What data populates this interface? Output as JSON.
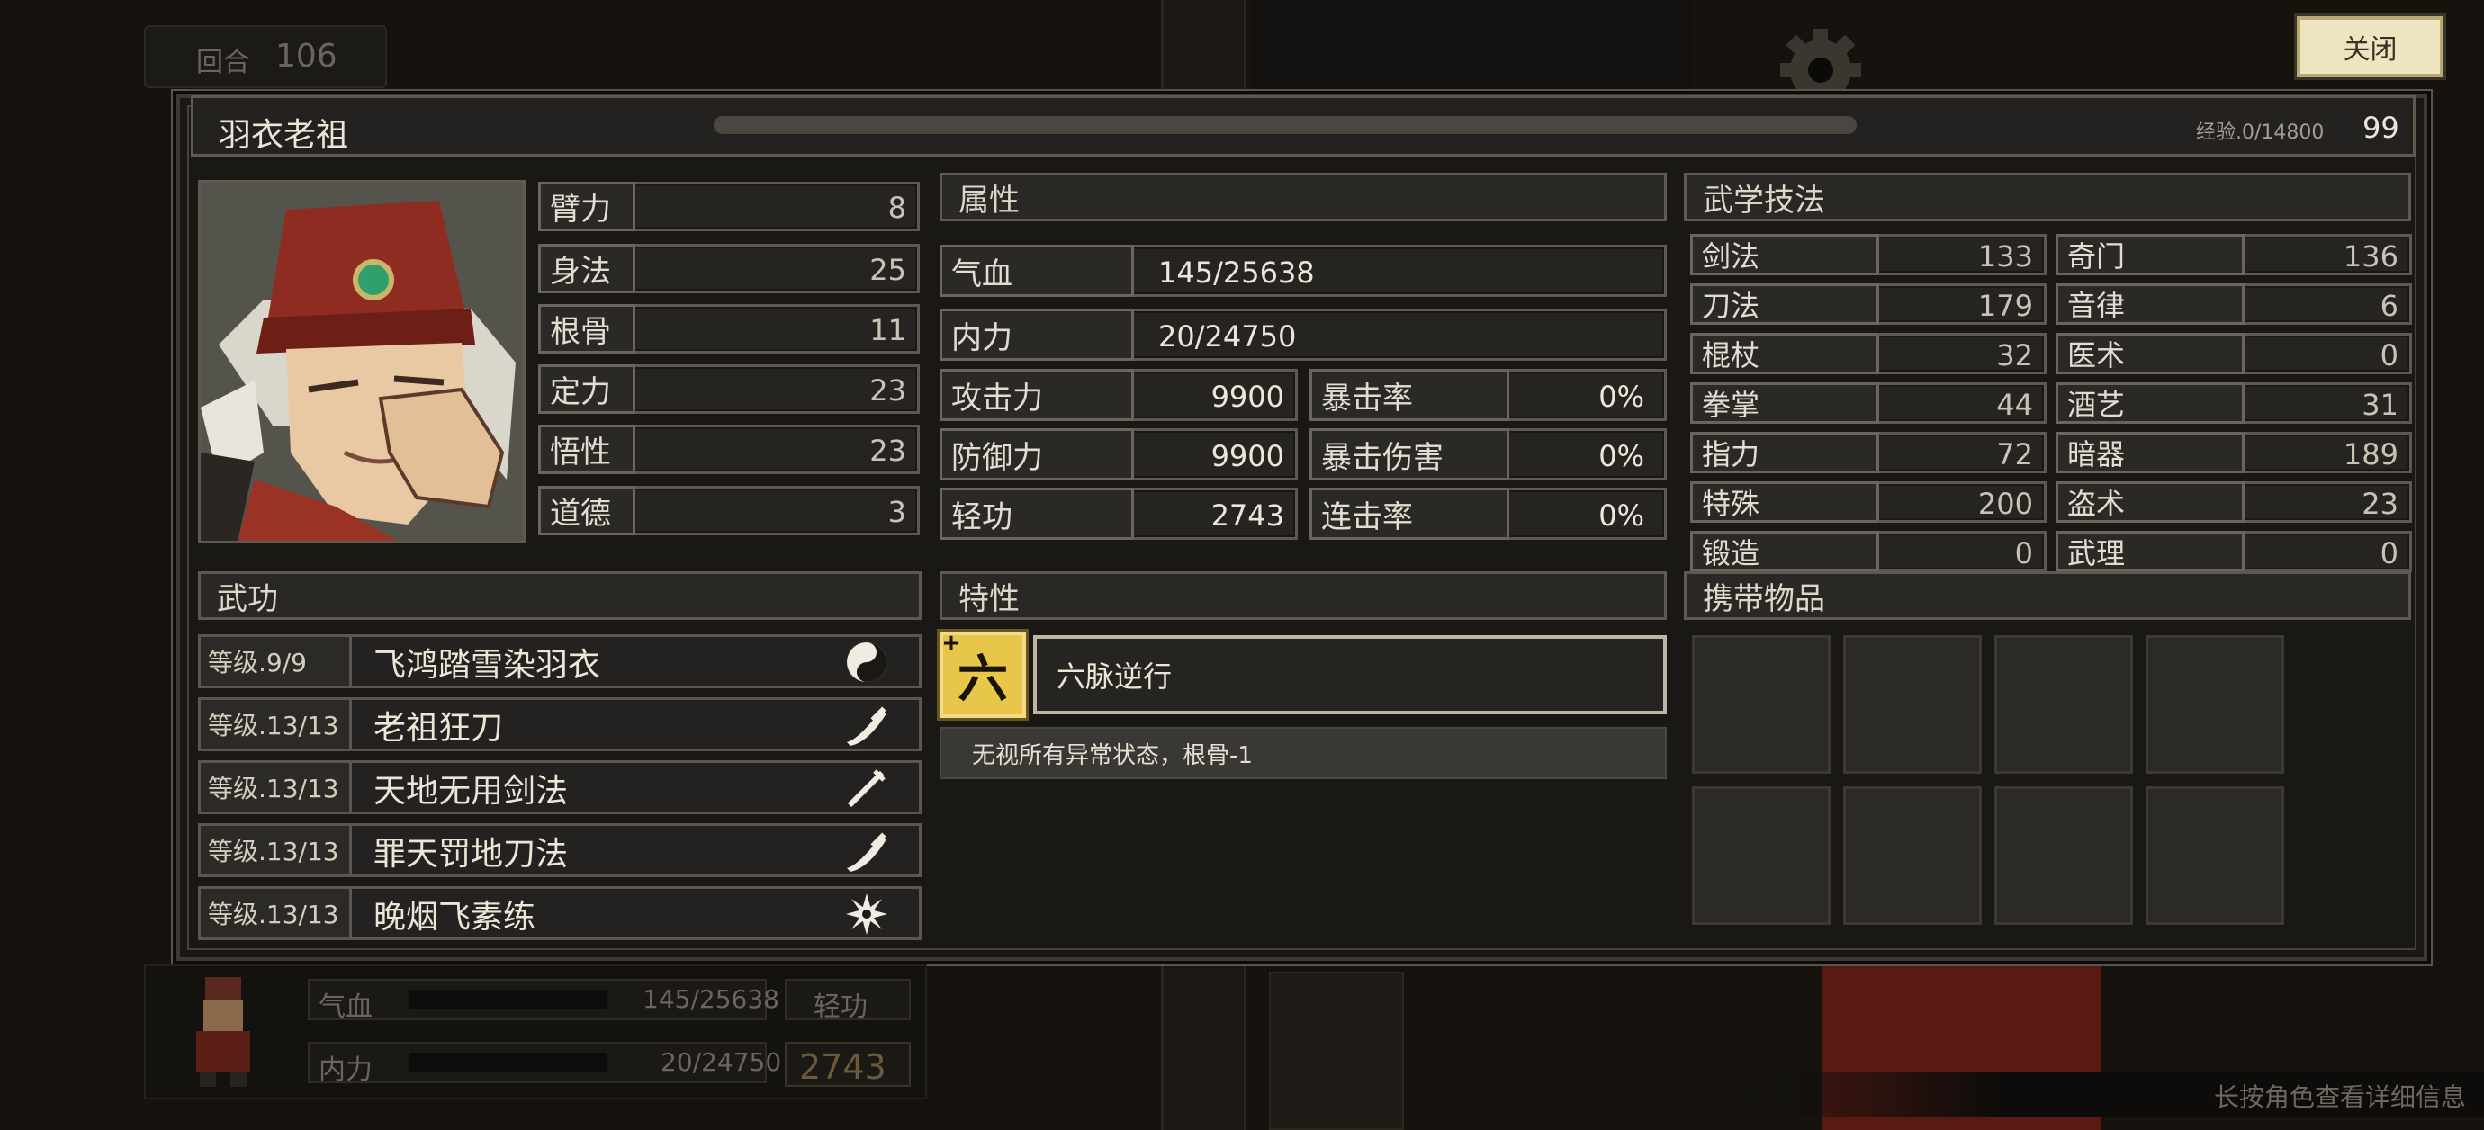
{
  "hud_top": {
    "round_label": "回合",
    "round_value": "106"
  },
  "close_button": "关闭",
  "character": {
    "name": "羽衣老祖",
    "exp_label": "经验.0/14800",
    "level": "99",
    "exp_fraction": 0.0
  },
  "base_stats": [
    {
      "label": "臂力",
      "value": "8"
    },
    {
      "label": "身法",
      "value": "25"
    },
    {
      "label": "根骨",
      "value": "11"
    },
    {
      "label": "定力",
      "value": "23"
    },
    {
      "label": "悟性",
      "value": "23"
    },
    {
      "label": "道德",
      "value": "3"
    }
  ],
  "attributes": {
    "title": "属性",
    "hp": {
      "label": "气血",
      "value": "145/25638"
    },
    "mp": {
      "label": "内力",
      "value": "20/24750"
    },
    "attack": {
      "label": "攻击力",
      "value": "9900"
    },
    "defense": {
      "label": "防御力",
      "value": "9900"
    },
    "agility": {
      "label": "轻功",
      "value": "2743"
    },
    "crit_rate": {
      "label": "暴击率",
      "value": "0%"
    },
    "crit_damage": {
      "label": "暴击伤害",
      "value": "0%"
    },
    "combo_rate": {
      "label": "连击率",
      "value": "0%"
    }
  },
  "martial_skills": {
    "title": "武学技法",
    "left": [
      {
        "label": "剑法",
        "value": "133"
      },
      {
        "label": "刀法",
        "value": "179"
      },
      {
        "label": "棍杖",
        "value": "32"
      },
      {
        "label": "拳掌",
        "value": "44"
      },
      {
        "label": "指力",
        "value": "72"
      },
      {
        "label": "特殊",
        "value": "200"
      },
      {
        "label": "锻造",
        "value": "0"
      }
    ],
    "right": [
      {
        "label": "奇门",
        "value": "136"
      },
      {
        "label": "音律",
        "value": "6"
      },
      {
        "label": "医术",
        "value": "0"
      },
      {
        "label": "酒艺",
        "value": "31"
      },
      {
        "label": "暗器",
        "value": "189"
      },
      {
        "label": "盗术",
        "value": "23"
      },
      {
        "label": "武理",
        "value": "0"
      }
    ]
  },
  "wugong": {
    "title": "武功",
    "items": [
      {
        "level": "等级.9/9",
        "name": "飞鸿踏雪染羽衣",
        "icon": "yin-yang-icon"
      },
      {
        "level": "等级.13/13",
        "name": "老祖狂刀",
        "icon": "saber-icon"
      },
      {
        "level": "等级.13/13",
        "name": "天地无用剑法",
        "icon": "crossed-swords-icon"
      },
      {
        "level": "等级.13/13",
        "name": "罪天罚地刀法",
        "icon": "saber-icon"
      },
      {
        "level": "等级.13/13",
        "name": "晚烟飞素练",
        "icon": "shuriken-icon"
      }
    ]
  },
  "traits": {
    "title": "特性",
    "badge_char": "六",
    "name": "六脉逆行",
    "description": "无视所有异常状态，根骨-1"
  },
  "items": {
    "title": "携带物品"
  },
  "hud_bottom": {
    "hp_label": "气血",
    "hp_value": "145/25638",
    "mp_label": "内力",
    "mp_value": "20/24750",
    "agility_label": "轻功",
    "agility_value": "2743",
    "hint": "长按角色查看详细信息"
  },
  "colors": {
    "panel_bg": "#1a1815",
    "border": "#5d5850",
    "gold": "#e8c64a",
    "button_bg": "#f0e6c2"
  }
}
